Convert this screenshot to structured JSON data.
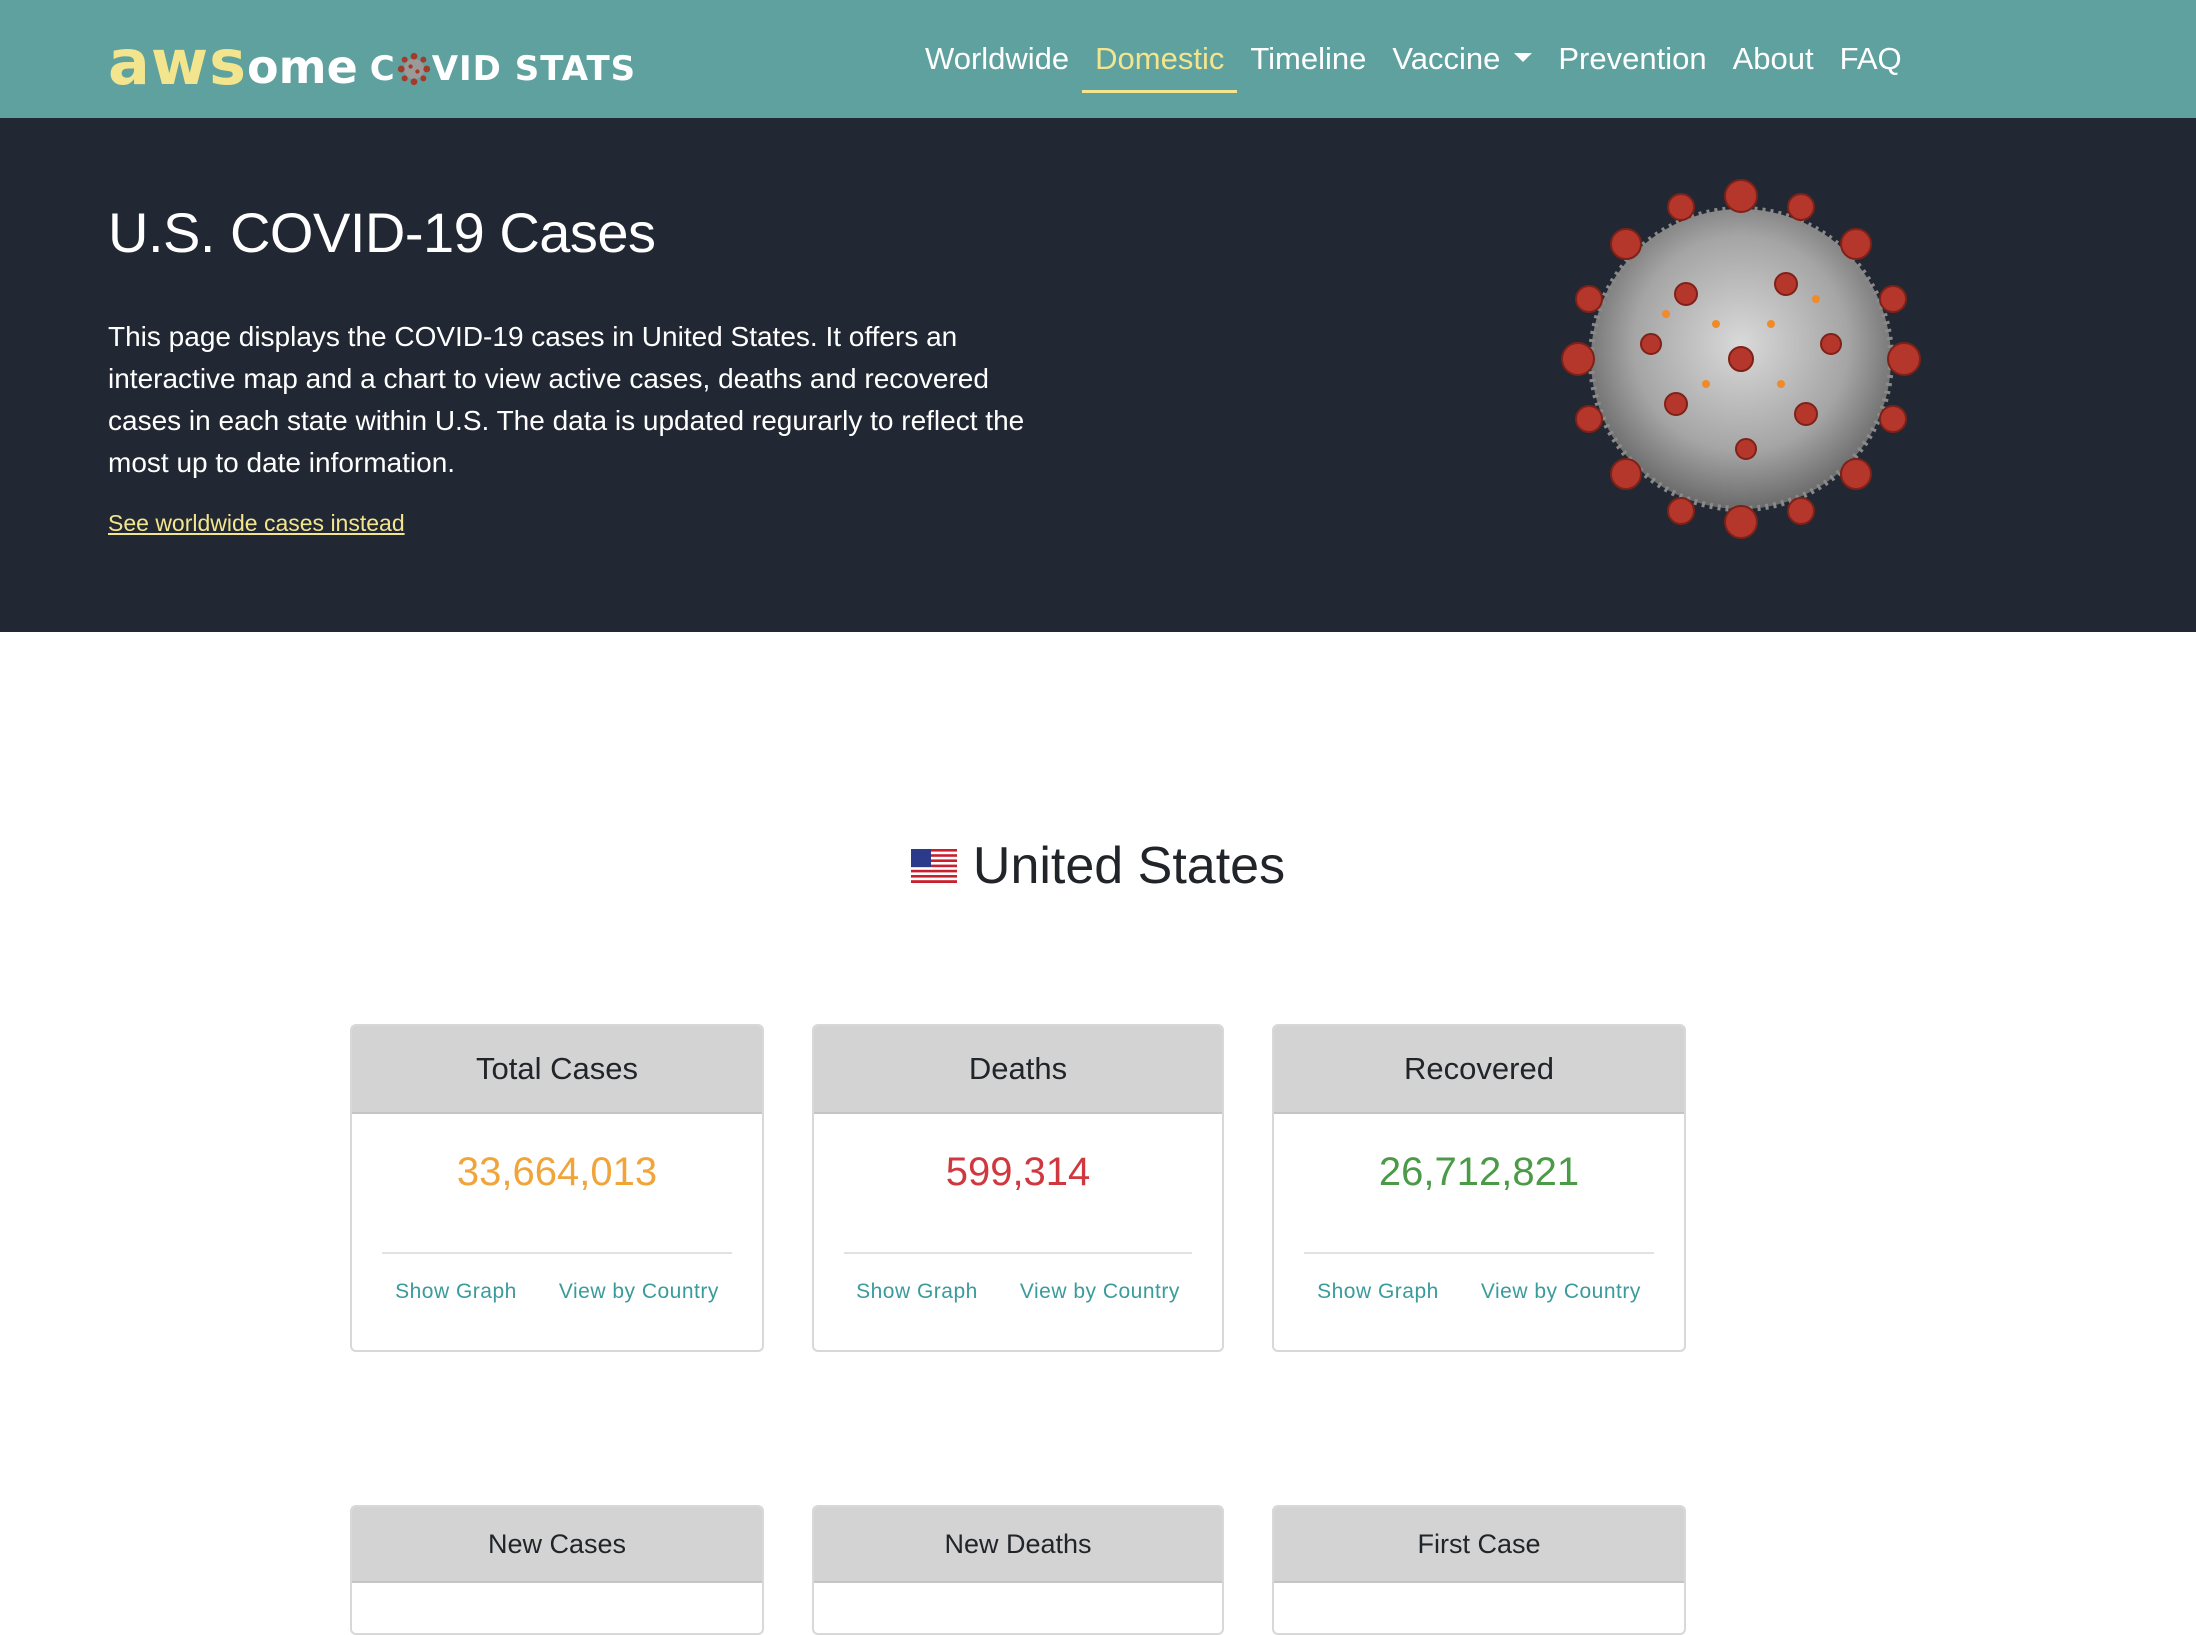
{
  "brand": {
    "part1": "aws",
    "part2": "ome",
    "part3_a": "C",
    "part3_b": "VID STATS"
  },
  "nav": {
    "items": [
      {
        "label": "Worldwide"
      },
      {
        "label": "Domestic"
      },
      {
        "label": "Timeline"
      },
      {
        "label": "Vaccine"
      },
      {
        "label": "Prevention"
      },
      {
        "label": "About"
      },
      {
        "label": "FAQ"
      }
    ],
    "active": "Domestic"
  },
  "hero": {
    "title": "U.S. COVID-19 Cases",
    "description": "This page displays the COVID-19 cases in United States. It offers an interactive map and a chart to view active cases, deaths and recovered cases in each state within U.S. The data is updated regurarly to reflect the most up to date information.",
    "link": "See worldwide cases instead"
  },
  "country": {
    "name": "United States"
  },
  "stats": [
    {
      "title": "Total Cases",
      "value": "33,664,013",
      "color": "#f0a43a",
      "link1": "Show Graph",
      "link2": "View by Country"
    },
    {
      "title": "Deaths",
      "value": "599,314",
      "color": "#d0383f",
      "link1": "Show Graph",
      "link2": "View by Country"
    },
    {
      "title": "Recovered",
      "value": "26,712,821",
      "color": "#4a9a47",
      "link1": "Show Graph",
      "link2": "View by Country"
    }
  ],
  "stats2": [
    {
      "title": "New Cases"
    },
    {
      "title": "New Deaths"
    },
    {
      "title": "First Case"
    }
  ],
  "colors": {
    "navbar": "#5fa19f",
    "accent": "#f2e58e",
    "hero": "#222833",
    "link": "#3a9b9b"
  }
}
